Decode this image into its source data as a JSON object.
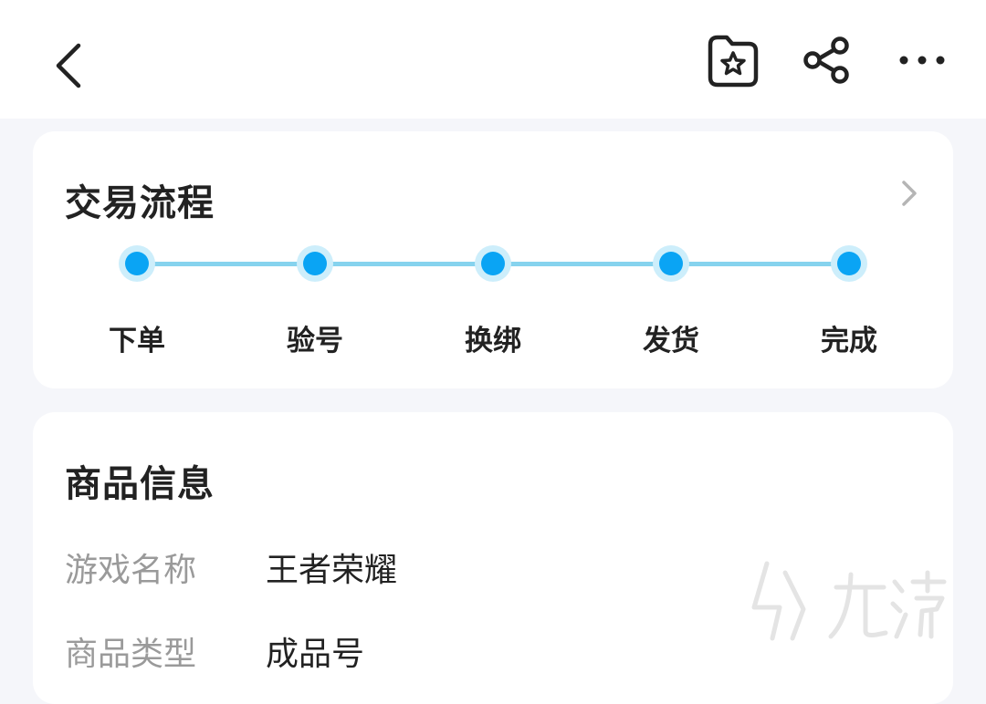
{
  "header": {
    "back_icon": "chevron-left-icon",
    "favorite_icon": "star-folder-icon",
    "share_icon": "share-icon",
    "more_icon": "more-dots-icon"
  },
  "process": {
    "title": "交易流程",
    "chevron_icon": "chevron-right-icon",
    "accent_color": "#0aa4f4",
    "steps": [
      {
        "label": "下单"
      },
      {
        "label": "验号"
      },
      {
        "label": "换绑"
      },
      {
        "label": "发货"
      },
      {
        "label": "完成"
      }
    ]
  },
  "product_info": {
    "title": "商品信息",
    "rows": [
      {
        "label": "游戏名称",
        "value": "王者荣耀"
      },
      {
        "label": "商品类型",
        "value": "成品号"
      }
    ]
  },
  "watermark": {
    "text": "九游"
  }
}
